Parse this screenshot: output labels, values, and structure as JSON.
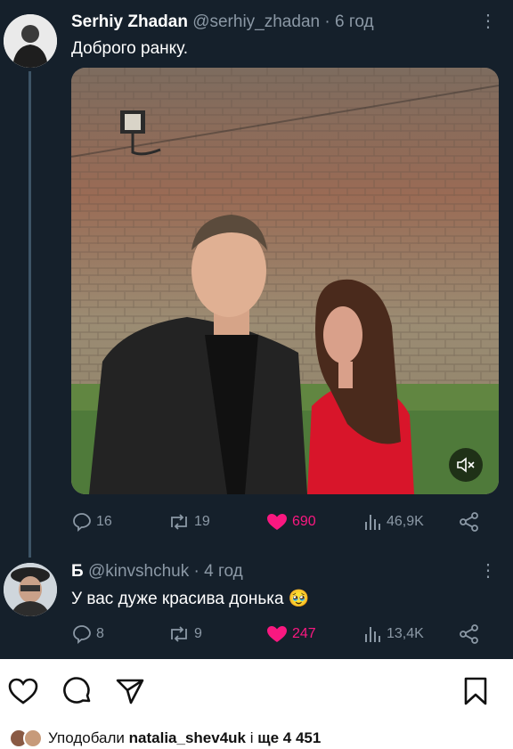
{
  "colors": {
    "background": "#15202b",
    "text": "#e7e9ea",
    "muted": "#8b98a5",
    "like": "#f91880",
    "thread_line": "#3d5466"
  },
  "tweet": {
    "display_name": "Serhiy Zhadan",
    "handle": "@serhiy_zhadan",
    "separator": "·",
    "time": "6 год",
    "text": "Доброго ранку.",
    "media": {
      "type": "video",
      "mute_icon": "speaker-muted-icon"
    },
    "stats": {
      "replies": "16",
      "retweets": "19",
      "likes": "690",
      "views": "46,9K"
    }
  },
  "reply": {
    "display_name": "Б",
    "handle": "@kinvshchuk",
    "separator": "·",
    "time": "4 год",
    "text": "У вас дуже красива донька",
    "emoji": "🥹",
    "stats": {
      "replies": "8",
      "retweets": "9",
      "likes": "247",
      "views": "13,4K"
    }
  },
  "instagram_bar": {
    "icons": [
      "heart-icon",
      "comment-icon",
      "share-icon",
      "bookmark-icon"
    ],
    "likes_prefix": "Уподобали",
    "likes_user": "natalia_shev4uk",
    "likes_mid": "і",
    "likes_suffix": "ще 4 451"
  }
}
